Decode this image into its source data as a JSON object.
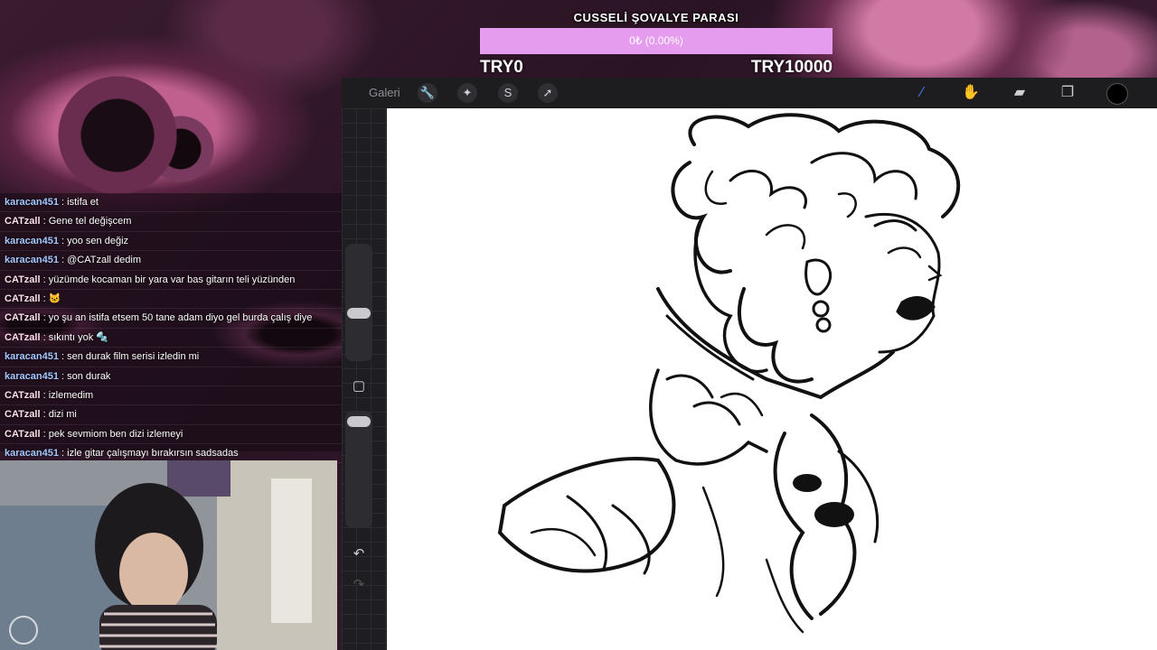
{
  "donation": {
    "title": "CUSSELİ ŞOVALYE PARASI",
    "progress_text": "0₺ (0.00%)",
    "progress_fraction": 0.0,
    "min_label": "TRY0",
    "max_label": "TRY10000",
    "bar_color": "#e59cef"
  },
  "procreate": {
    "gallery_label": "Galeri",
    "left_tools": [
      "wrench-icon",
      "magic-wand-icon",
      "selection-icon",
      "transform-arrow-icon"
    ],
    "right_tools": [
      "brush-icon",
      "smudge-icon",
      "eraser-icon",
      "layers-icon",
      "color-icon"
    ],
    "current_color": "#000000"
  },
  "chat": {
    "messages": [
      {
        "user": "karacan451",
        "text": ": istifa et"
      },
      {
        "user": "CATzall",
        "text": ": Gene tel değişcem"
      },
      {
        "user": "karacan451",
        "text": ": yoo sen değiz"
      },
      {
        "user": "karacan451",
        "text": ": @CATzall dedim"
      },
      {
        "user": "CATzall",
        "text": ": yüzümde kocaman bir yara var bas gitarın teli yüzünden"
      },
      {
        "user": "CATzall",
        "text": ": 🐱"
      },
      {
        "user": "CATzall",
        "text": ": yo şu an istifa etsem 50 tane adam diyo gel burda çalış diye"
      },
      {
        "user": "CATzall",
        "text": ": sıkıntı yok 🔩"
      },
      {
        "user": "karacan451",
        "text": ": sen durak film serisi izledin mi"
      },
      {
        "user": "karacan451",
        "text": ": son durak"
      },
      {
        "user": "CATzall",
        "text": ": izlemedim"
      },
      {
        "user": "CATzall",
        "text": ": dizi mi"
      },
      {
        "user": "CATzall",
        "text": ": pek sevmiom ben dizi izlemeyi"
      },
      {
        "user": "karacan451",
        "text": ": izle gitar çalışmayı bırakırsın sadsadas"
      }
    ]
  },
  "sidebar": {
    "undo_icon": "undo-icon",
    "redo_icon": "redo-icon"
  }
}
